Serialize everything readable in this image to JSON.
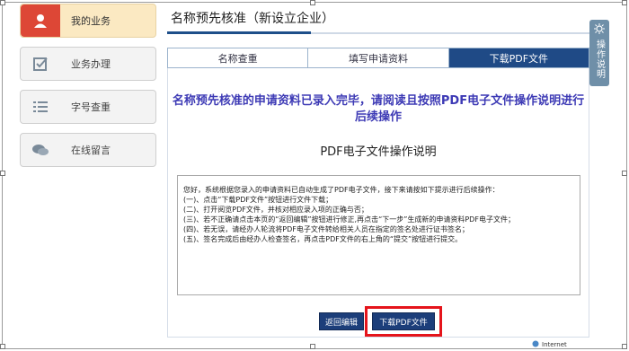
{
  "sidebar": {
    "items": [
      {
        "label": "我的业务",
        "icon": "user-icon"
      },
      {
        "label": "业务办理",
        "icon": "checkbox-icon"
      },
      {
        "label": "字号查重",
        "icon": "list-icon"
      },
      {
        "label": "在线留言",
        "icon": "chat-icon"
      }
    ]
  },
  "header": {
    "title": "名称预先核准（新设立企业）"
  },
  "help": {
    "label": "操作说明",
    "icon": "sun-icon"
  },
  "tabs": [
    "名称查重",
    "填写申请资料",
    "下载PDF文件"
  ],
  "notice": "名称预先核准的申请资料已录入完毕，请阅读且按照PDF电子文件操作说明进行后续操作",
  "pdf_heading": "PDF电子文件操作说明",
  "instructions": [
    "您好，系统根据您录入的申请资料已自动生成了PDF电子文件，接下来请按如下提示进行后续操作：",
    "(一)、点击“下载PDF文件”按钮进行文件下载；",
    "(二)、打开阅览PDF文件，并核对相应录入项的正确与否；",
    "(三)、若不正确请点击本页的“返回编辑”按钮进行修正,再点击“下一步”生成新的申请资料PDF电子文件；",
    "(四)、若无误，请经办人轮流将PDF电子文件转给相关人员在指定的签名处进行证书签名；",
    "(五)、签名完成后由经办人检查签名，再点击PDF文件的右上角的“提交”按钮进行提交。"
  ],
  "buttons": {
    "back": "返回编辑",
    "download": "下载PDF文件"
  },
  "status": {
    "zone": "Internet"
  },
  "colors": {
    "accent": "#1f4a86",
    "highlight": "#e5141b",
    "notice": "#3d3ab5",
    "active_icon_bg": "#dd4736"
  }
}
